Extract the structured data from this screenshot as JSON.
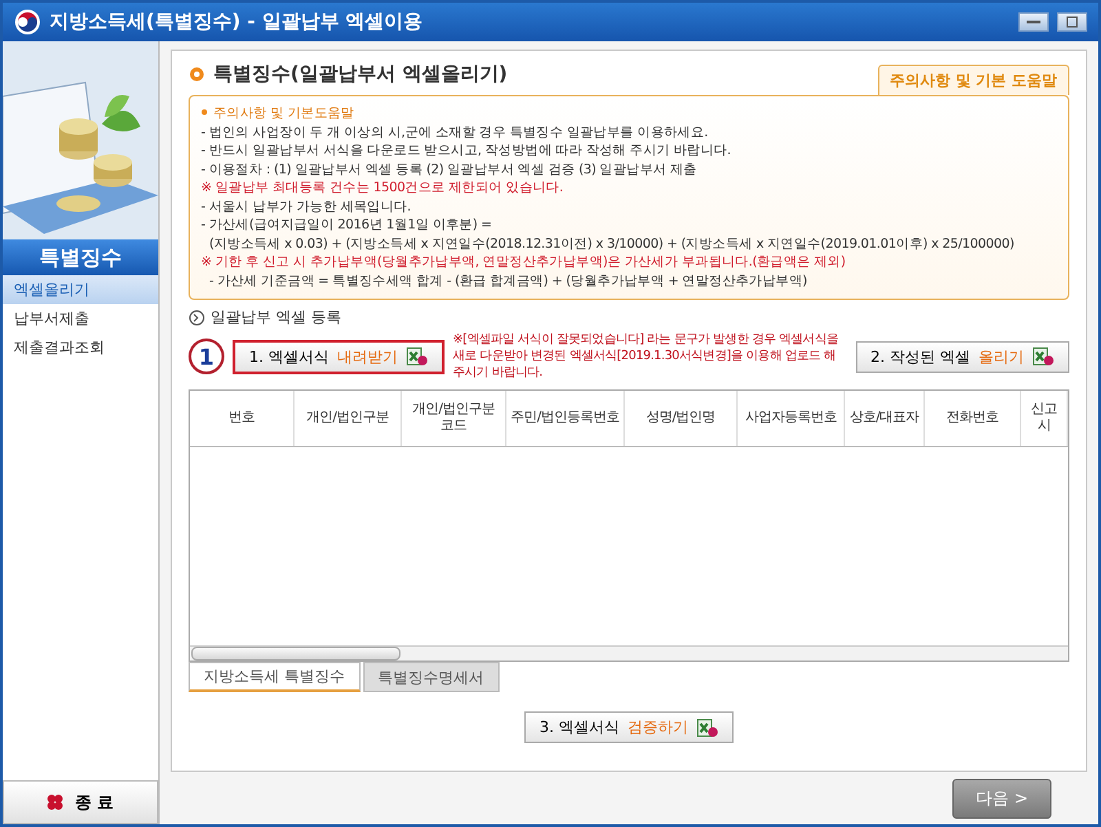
{
  "window": {
    "title": "지방소득세(특별징수) - 일괄납부 엑셀이용"
  },
  "sidebar": {
    "header": "특별징수",
    "items": [
      {
        "label": "엑셀올리기",
        "selected": true
      },
      {
        "label": "납부서제출",
        "selected": false
      },
      {
        "label": "제출결과조회",
        "selected": false
      }
    ],
    "exit_button": "종 료"
  },
  "page": {
    "title": "특별징수(일괄납부서 엑셀올리기)",
    "help_tab": "주의사항 및 기본 도움말",
    "notice": [
      {
        "kind": "bullet",
        "text": "주의사항 및 기본도움말"
      },
      {
        "kind": "normal",
        "text": "- 법인의 사업장이 두 개 이상의 시,군에 소재할 경우 특별징수 일괄납부를 이용하세요."
      },
      {
        "kind": "normal",
        "text": "- 반드시 일괄납부서 서식을 다운로드 받으시고, 작성방법에 따라 작성해 주시기 바랍니다."
      },
      {
        "kind": "normal",
        "text": "- 이용절차 : (1) 일괄납부서 엑셀 등록  (2) 일괄납부서 엑셀 검증 (3) 일괄납부서 제출"
      },
      {
        "kind": "warning",
        "text": "※ 일괄납부 최대등록 건수는 1500건으로 제한되어 있습니다."
      },
      {
        "kind": "normal",
        "text": "- 서울시 납부가 가능한 세목입니다."
      },
      {
        "kind": "normal",
        "text": "- 가산세(급여지급일이 2016년 1월1일 이후분) ="
      },
      {
        "kind": "indent",
        "text": "(지방소득세 x 0.03) + (지방소득세 x 지연일수(2018.12.31이전) x 3/10000) + (지방소득세 x 지연일수(2019.01.01이후) x 25/100000)"
      },
      {
        "kind": "warning",
        "text": "※ 기한 후 신고 시 추가납부액(당월추가납부액, 연말정산추가납부액)은 가산세가 부과됩니다.(환급액은 제외)"
      },
      {
        "kind": "indent",
        "text": "- 가산세 기준금액 = 특별징수세액 합계 - (환급 합계금액) + (당월추가납부액 + 연말정산추가납부액)"
      }
    ],
    "section_title": "일괄납부 엑셀 등록",
    "step_marker": "1",
    "download_button": {
      "prefix": "1. 엑셀서식",
      "action": "내려받기",
      "highlighted": true
    },
    "warning_text": "※[엑셀파일 서식이 잘못되었습니다] 라는 문구가 발생한 경우 엑셀서식을 새로 다운받아 변경된 엑셀서식[2019.1.30서식변경]을 이용해 업로드 해주시기 바랍니다.",
    "upload_button": {
      "prefix": "2. 작성된 엑셀",
      "action": "올리기",
      "highlighted": false
    },
    "table": {
      "columns": [
        "번호",
        "개인/법인구분",
        "개인/법인구분\n코드",
        "주민/법인등록번호",
        "성명/법인명",
        "사업자등록번호",
        "상호/대표자",
        "전화번호",
        "신고\n시"
      ]
    },
    "sheet_tabs": [
      {
        "label": "지방소득세 특별징수",
        "selected": true
      },
      {
        "label": "특별징수명세서",
        "selected": false
      }
    ],
    "verify_button": {
      "prefix": "3. 엑셀서식",
      "action": "검증하기",
      "highlighted": false
    }
  },
  "next_button": "다음 >"
}
